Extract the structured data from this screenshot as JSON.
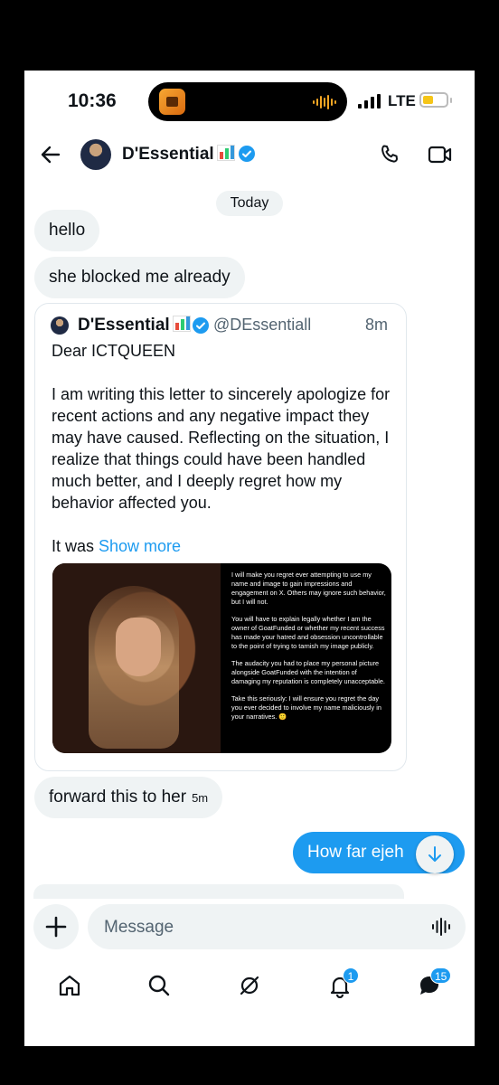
{
  "status_bar": {
    "time": "10:36",
    "network": "LTE"
  },
  "header": {
    "name": "D'Essential"
  },
  "date_divider": "Today",
  "messages": {
    "hello": "hello",
    "blocked": "she blocked me already",
    "forward": "forward this to her",
    "forward_time": "5m",
    "outgoing": "How far ejeh"
  },
  "quoted_post": {
    "name": "D'Essential",
    "handle": "@DEssentiall",
    "time": "8m",
    "greeting": "Dear ICTQUEEN",
    "paragraph": "I am writing this letter to sincerely apologize for  recent actions and any negative impact they may have caused. Reflecting on the situation, I realize that things could have been handled much better, and I deeply regret how my behavior affected you.",
    "truncated": "It was ",
    "show_more": "Show more",
    "image_text": [
      "I will make you regret ever attempting to use my name and image to gain impressions and engagement on X. Others may ignore such behavior, but I will not.",
      "You will have to explain legally whether I am the owner of GoatFunded or whether my recent success has made your hatred and obsession uncontrollable to the point of trying to tarnish my image publicly.",
      "The audacity you had to place my personal picture alongside GoatFunded with the intention of damaging my reputation is completely unacceptable.",
      "Take this seriously: I will ensure you regret the day you ever decided to involve my name maliciously in your narratives. 🙂"
    ]
  },
  "compose": {
    "placeholder": "Message"
  },
  "nav": {
    "notifications_badge": "1",
    "messages_badge": "15"
  },
  "colors": {
    "accent": "#1d9bf0",
    "bubble_bg": "#eff3f4"
  }
}
